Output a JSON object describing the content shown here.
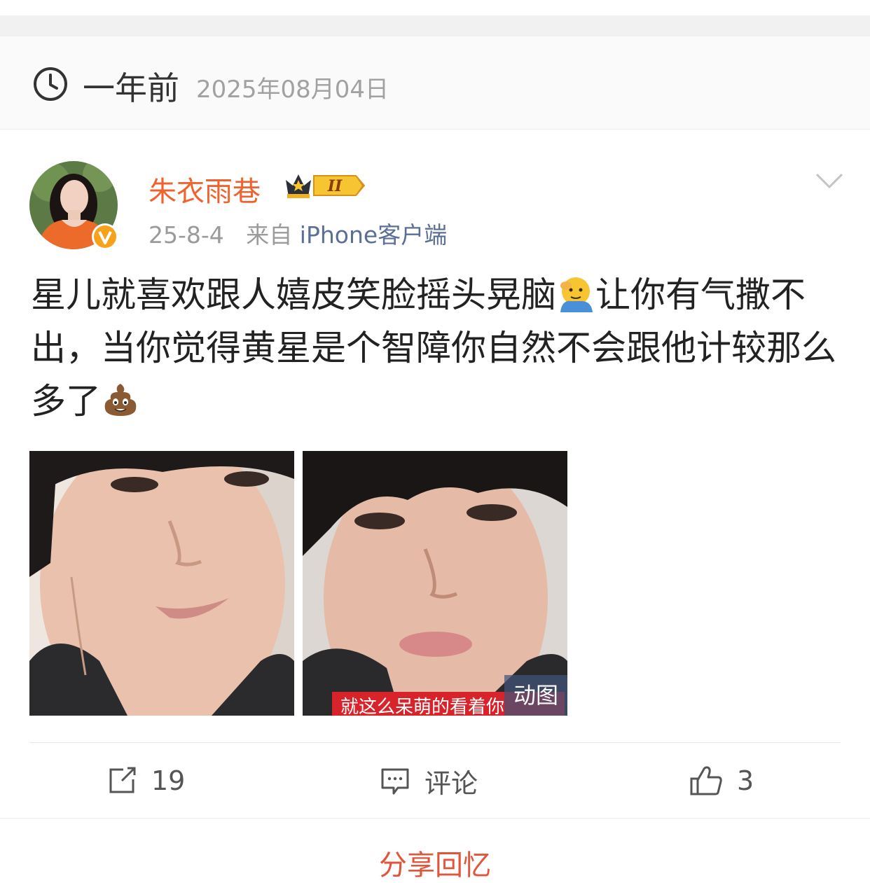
{
  "memory": {
    "ago": "一年前",
    "date": "2025年08月04日"
  },
  "post": {
    "author": "朱衣雨巷",
    "vip_level": "II",
    "time": "25-8-4",
    "source_prefix": "来自",
    "source": "iPhone客户端",
    "text_part1": "星儿就喜欢跟人嬉皮笑脸摇头晃脑",
    "text_part2": "让你有气撒不出，当你觉得黄星是个智障你自然不会跟他计较那么多了",
    "images": [
      {
        "gif": false
      },
      {
        "gif": true,
        "gif_label": "动图",
        "caption": "就这么呆萌的看着你"
      }
    ]
  },
  "actions": {
    "repost_count": "19",
    "comment_label": "评论",
    "like_count": "3"
  },
  "footer": {
    "share_label": "分享回忆"
  },
  "colors": {
    "username": "#f0632e",
    "source_link": "#5b6f96",
    "share": "#e1553b"
  }
}
